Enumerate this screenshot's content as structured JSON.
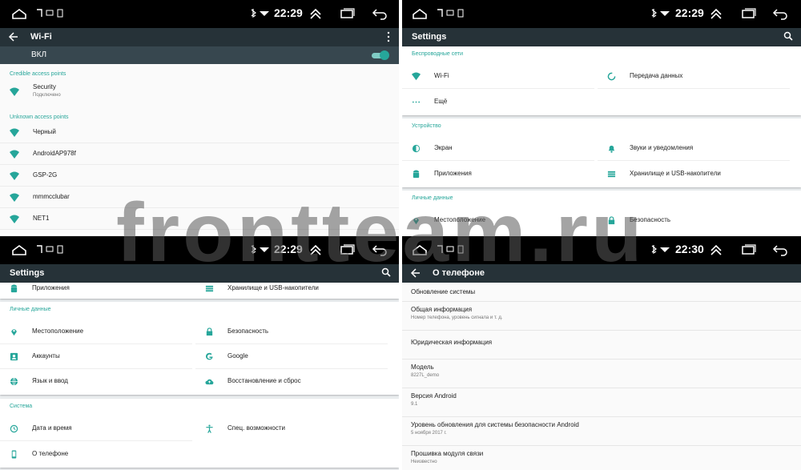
{
  "status": {
    "q1_clock": "22:29",
    "q2_clock": "22:29",
    "q3_clock": "22:29",
    "q4_clock": "22:30"
  },
  "wifi": {
    "title": "Wi-Fi",
    "switch_label": "ВКЛ",
    "credible_header": "Credible access points",
    "unknown_header": "Unknown access points",
    "credible": [
      {
        "name": "Security",
        "status": "Подключено"
      }
    ],
    "unknown": [
      {
        "name": "Черный"
      },
      {
        "name": "AndroidAP978f"
      },
      {
        "name": "GSP-2G"
      },
      {
        "name": "mmmcclubar"
      },
      {
        "name": "NET1"
      }
    ]
  },
  "settings1": {
    "title": "Settings",
    "wireless": {
      "header": "Беспроводные сети",
      "wifi": "Wi-Fi",
      "data": "Передача данных",
      "more": "Ещё"
    },
    "device": {
      "header": "Устройство",
      "screen": "Экран",
      "sound": "Звуки и уведомления",
      "apps": "Приложения",
      "storage": "Хранилище и USB-накопители"
    },
    "personal": {
      "header": "Личные данные",
      "location": "Местоположение",
      "security": "Безопасность"
    }
  },
  "settings2": {
    "title": "Settings",
    "apps": "Приложения",
    "storage": "Хранилище и USB-накопители",
    "personal": {
      "header": "Личные данные",
      "location": "Местоположение",
      "security": "Безопасность",
      "accounts": "Аккаунты",
      "google": "Google",
      "lang": "Язык и ввод",
      "backup": "Восстановление и сброс"
    },
    "system": {
      "header": "Система",
      "datetime": "Дата и время",
      "access": "Спец. возможности",
      "about": "О телефоне"
    }
  },
  "about": {
    "title": "О телефоне",
    "items": [
      {
        "title": "Обновление системы",
        "sub": ""
      },
      {
        "title": "Общая информация",
        "sub": "Номер телефона, уровень сигнала и т. д."
      },
      {
        "title": "Юридическая информация",
        "sub": ""
      },
      {
        "title": "Модель",
        "sub": "8227L_demo"
      },
      {
        "title": "Версия Android",
        "sub": "9.1"
      },
      {
        "title": "Уровень обновления для системы безопасности Android",
        "sub": "5 ноября 2017 г."
      },
      {
        "title": "Прошивка модуля связи",
        "sub": "Неизвестно"
      }
    ]
  },
  "watermark": "frontteam.ru",
  "colors": {
    "accent": "#26a69a",
    "toolbar": "#263238",
    "switchbar": "#37474f"
  }
}
